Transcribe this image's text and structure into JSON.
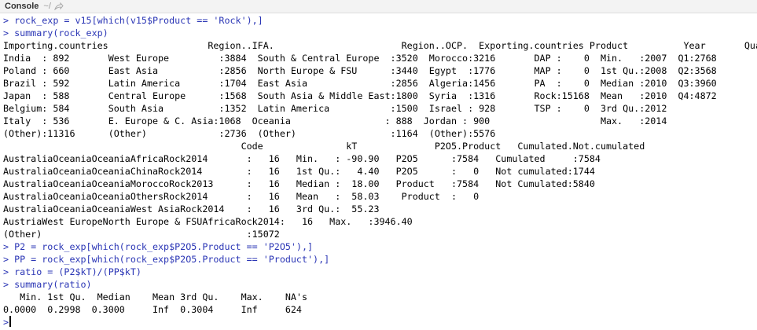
{
  "header": {
    "title": "Console",
    "path": "~/",
    "icon": "share-arrow-icon"
  },
  "colors": {
    "input": "#2a35b5",
    "output": "#000000",
    "header_bg": "#f3f3f3"
  },
  "console": {
    "lines": [
      {
        "type": "input",
        "text": "> rock_exp = v15[which(v15$Product == 'Rock'),]"
      },
      {
        "type": "input",
        "text": "> summary(rock_exp)"
      },
      {
        "type": "output",
        "text": "Importing.countries                  Region..IFA.                       Region..OCP.  Exporting.countries Product          Year       Quarter"
      },
      {
        "type": "output",
        "text": "India  : 892       West Europe         :3884  South & Central Europe  :3520  Morocco:3216       DAP :    0  Min.   :2007  Q1:2768"
      },
      {
        "type": "output",
        "text": "Poland : 660       East Asia           :2856  North Europe & FSU      :3440  Egypt  :1776       MAP :    0  1st Qu.:2008  Q2:3568"
      },
      {
        "type": "output",
        "text": "Brazil : 592       Latin America       :1704  East Asia               :2856  Algeria:1456       PA  :    0  Median :2010  Q3:3960"
      },
      {
        "type": "output",
        "text": "Japan  : 588       Central Europe      :1568  South Asia & Middle East:1800  Syria  :1316       Rock:15168  Mean   :2010  Q4:4872"
      },
      {
        "type": "output",
        "text": "Belgium: 584       South Asia          :1352  Latin America           :1500  Israel : 928       TSP :    0  3rd Qu.:2012"
      },
      {
        "type": "output",
        "text": "Italy  : 536       E. Europe & C. Asia:1068  Oceania                 : 888  Jordan : 900                    Max.   :2014"
      },
      {
        "type": "output",
        "text": "(Other):11316      (Other)             :2736  (Other)                 :1164  (Other):5576"
      },
      {
        "type": "output",
        "text": "                                           Code               kT              P2O5.Product   Cumulated.Not.cumulated"
      },
      {
        "type": "output",
        "text": "AustraliaOceaniaOceaniaAfricaRock2014       :   16   Min.   : -90.90   P2O5      :7584   Cumulated     :7584"
      },
      {
        "type": "output",
        "text": "AustraliaOceaniaOceaniaChinaRock2014        :   16   1st Qu.:   4.40   P2O5      :   0   Not cumulated:1744"
      },
      {
        "type": "output",
        "text": "AustraliaOceaniaOceaniaMoroccoRock2013      :   16   Median :  18.00   Product   :7584   Not Cumulated:5840"
      },
      {
        "type": "output",
        "text": "AustraliaOceaniaOceaniaOthersRock2014       :   16   Mean   :  58.03    Product  :   0"
      },
      {
        "type": "output",
        "text": "AustraliaOceaniaOceaniaWest AsiaRock2014    :   16   3rd Qu.:  55.23"
      },
      {
        "type": "output",
        "text": "AustriaWest EuropeNorth Europe & FSUAfricaRock2014:   16   Max.   :3946.40"
      },
      {
        "type": "output",
        "text": "(Other)                                     :15072"
      },
      {
        "type": "input",
        "text": "> P2 = rock_exp[which(rock_exp$P2O5.Product == 'P2O5'),]"
      },
      {
        "type": "input",
        "text": "> PP = rock_exp[which(rock_exp$P2O5.Product == 'Product'),]"
      },
      {
        "type": "input",
        "text": "> ratio = (P2$kT)/(PP$kT)"
      },
      {
        "type": "input",
        "text": "> summary(ratio)"
      },
      {
        "type": "output",
        "text": "   Min. 1st Qu.  Median    Mean 3rd Qu.    Max.    NA's"
      },
      {
        "type": "output",
        "text": "0.0000  0.2998  0.3000     Inf  0.3004     Inf     624"
      }
    ],
    "prompt": ">"
  }
}
